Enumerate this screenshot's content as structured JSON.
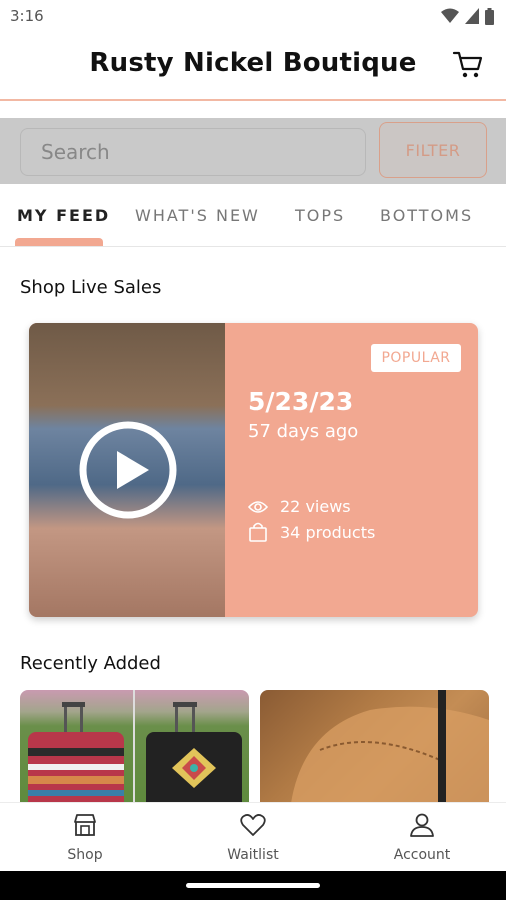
{
  "status_bar": {
    "time": "3:16"
  },
  "app_bar": {
    "title": "Rusty Nickel Boutique"
  },
  "search": {
    "placeholder": "Search",
    "filter_label": "FILTER"
  },
  "tabs": [
    {
      "label": "MY FEED",
      "active": true
    },
    {
      "label": "WHAT'S NEW"
    },
    {
      "label": "TOPS"
    },
    {
      "label": "BOTTOMS"
    }
  ],
  "live_sales": {
    "section_title": "Shop Live Sales",
    "card": {
      "badge": "POPULAR",
      "date": "5/23/23",
      "ago": "57 days ago",
      "views": "22 views",
      "products": "34 products"
    }
  },
  "recently_added": {
    "section_title": "Recently Added"
  },
  "bottom_nav": [
    {
      "label": "Shop",
      "icon": "shop-icon"
    },
    {
      "label": "Waitlist",
      "icon": "heart-icon"
    },
    {
      "label": "Account",
      "icon": "account-icon"
    }
  ],
  "colors": {
    "accent": "#f2a891",
    "accent_border": "#f2b8a3"
  }
}
